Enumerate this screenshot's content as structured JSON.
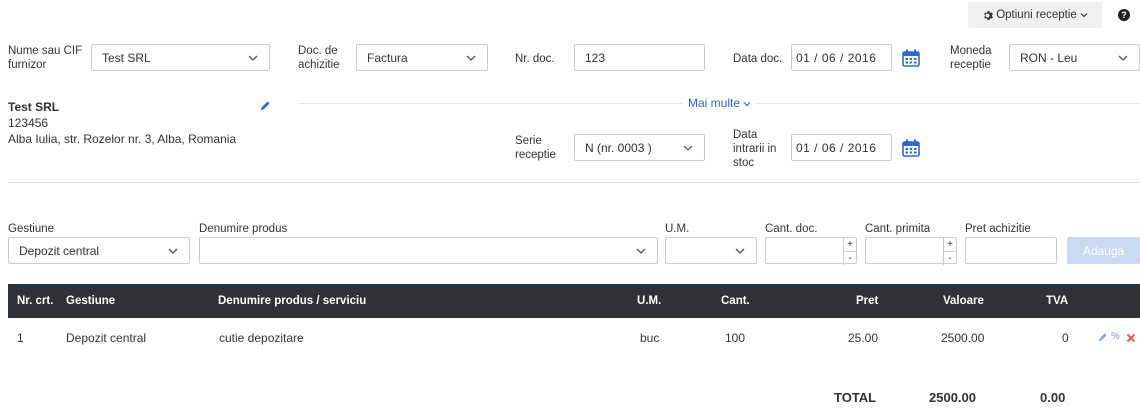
{
  "top": {
    "options_label": "Optiuni receptie",
    "help_icon": "question-circle-icon"
  },
  "header": {
    "supplier_label": "Nume sau CIF furnizor",
    "supplier_value": "Test SRL",
    "doc_type_label": "Doc. de achizitie",
    "doc_type_value": "Factura",
    "doc_nr_label": "Nr. doc.",
    "doc_nr_value": "123",
    "doc_date_label": "Data doc.",
    "doc_date_value": "01 / 06 / 2016",
    "currency_label": "Moneda receptie",
    "currency_value": "RON - Leu"
  },
  "supplier": {
    "name": "Test SRL",
    "cif": "123456",
    "address": "Alba Iulia, str. Rozelor nr. 3, Alba, Romania"
  },
  "more_label": "Mai multe",
  "extra": {
    "series_label": "Serie receptie",
    "series_value": "N (nr. 0003 )",
    "stock_date_label": "Data intrarii in stoc",
    "stock_date_value": "01 / 06 / 2016"
  },
  "entry": {
    "gestiune_label": "Gestiune",
    "gestiune_value": "Depozit central",
    "product_label": "Denumire produs",
    "product_value": "",
    "um_label": "U.M.",
    "um_value": "",
    "qty_doc_label": "Cant. doc.",
    "qty_recv_label": "Cant. primita",
    "price_label": "Pret achizitie",
    "add_label": "Adauga"
  },
  "table": {
    "headers": [
      "Nr. crt.",
      "Gestiune",
      "Denumire produs / serviciu",
      "U.M.",
      "Cant.",
      "Pret",
      "Valoare",
      "TVA"
    ],
    "rows": [
      {
        "nr": "1",
        "gestiune": "Depozit central",
        "produs": "cutie depozitare",
        "um": "buc",
        "cant": "100",
        "pret": "25.00",
        "valoare": "2500.00",
        "tva": "0"
      }
    ],
    "total_label": "TOTAL",
    "total_value": "2500.00",
    "total_tva": "0.00"
  },
  "colors": {
    "accent": "#2a6ad6",
    "header_bg": "#2d3138",
    "add_disabled": "#c8d9f0",
    "delete": "#e05c4b"
  }
}
